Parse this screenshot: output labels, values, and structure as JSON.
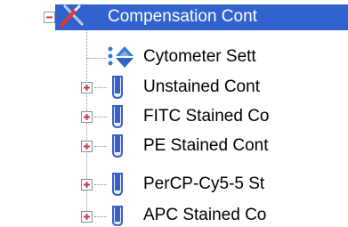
{
  "tree": {
    "root": {
      "label": "Compensation Cont",
      "icon": "compensation-tools-icon",
      "expanded": true,
      "selected": true
    },
    "children": [
      {
        "label": "Cytometer Sett",
        "icon": "cytometer-settings-icon",
        "expandable": false
      },
      {
        "label": "Unstained Cont",
        "icon": "tube-icon",
        "expandable": true
      },
      {
        "label": "FITC Stained Co",
        "icon": "tube-icon",
        "expandable": true
      },
      {
        "label": "PE Stained Cont",
        "icon": "tube-icon",
        "expandable": true
      },
      {
        "label": "PerCP-Cy5-5 St",
        "icon": "tube-icon",
        "expandable": true
      },
      {
        "label": "APC Stained Co",
        "icon": "tube-icon",
        "expandable": true
      }
    ]
  },
  "colors": {
    "selection": "#3162cd",
    "tube_blue": "#3a5fc8",
    "expander_border": "#7b8ea8",
    "collapse_red": "#c8384a"
  }
}
